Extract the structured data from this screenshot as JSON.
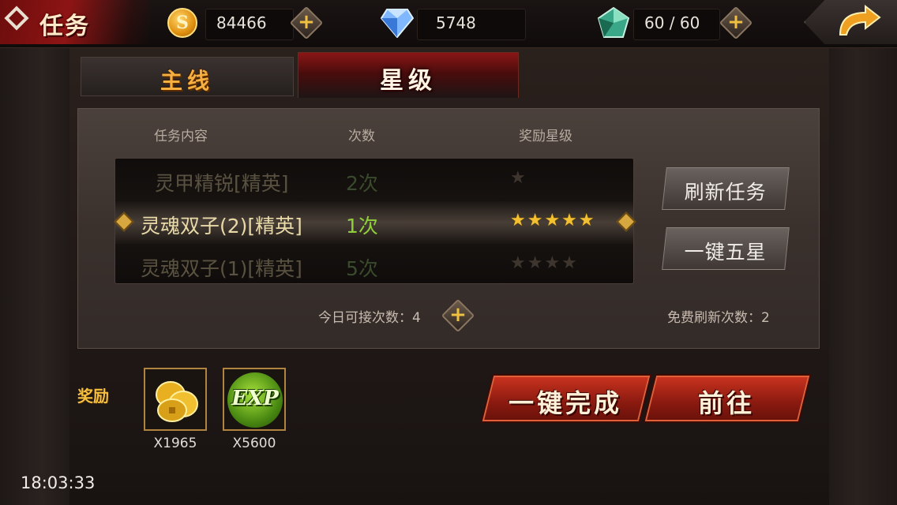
{
  "header": {
    "title": "任务",
    "coin_symbol": "S",
    "gold": "84466",
    "diamonds": "5748",
    "stamina": "60 / 60",
    "plus_symbol": "+"
  },
  "tabs": [
    {
      "label": "主线",
      "active": false
    },
    {
      "label": "星级",
      "active": true
    }
  ],
  "table": {
    "headers": [
      "任务内容",
      "次数",
      "奖励星级"
    ],
    "rows": [
      {
        "name": "灵甲精锐[精英]",
        "count": "2次",
        "stars": "★",
        "selected": false
      },
      {
        "name": "灵魂双子(2)[精英]",
        "count": "1次",
        "stars": "★★★★★",
        "selected": true
      },
      {
        "name": "灵魂双子(1)[精英]",
        "count": "5次",
        "stars": "★★★★",
        "selected": false
      }
    ]
  },
  "buttons": {
    "refresh": "刷新任务",
    "five_star": "一键五星",
    "complete": "一键完成",
    "go": "前往"
  },
  "footer": {
    "accept_label": "今日可接次数：4",
    "free_refresh_label": "免费刷新次数：2"
  },
  "rewards": {
    "label": "奖励",
    "items": [
      {
        "icon": "coins-icon",
        "qty": "X1965"
      },
      {
        "icon": "exp-icon",
        "text": "EXP",
        "qty": "X5600"
      }
    ]
  },
  "clock": "18:03:33",
  "colors": {
    "accent_red": "#8e1414",
    "gold_text": "#f5c040",
    "count_green": "#8fcf3a",
    "star_gold": "#f2c030"
  }
}
